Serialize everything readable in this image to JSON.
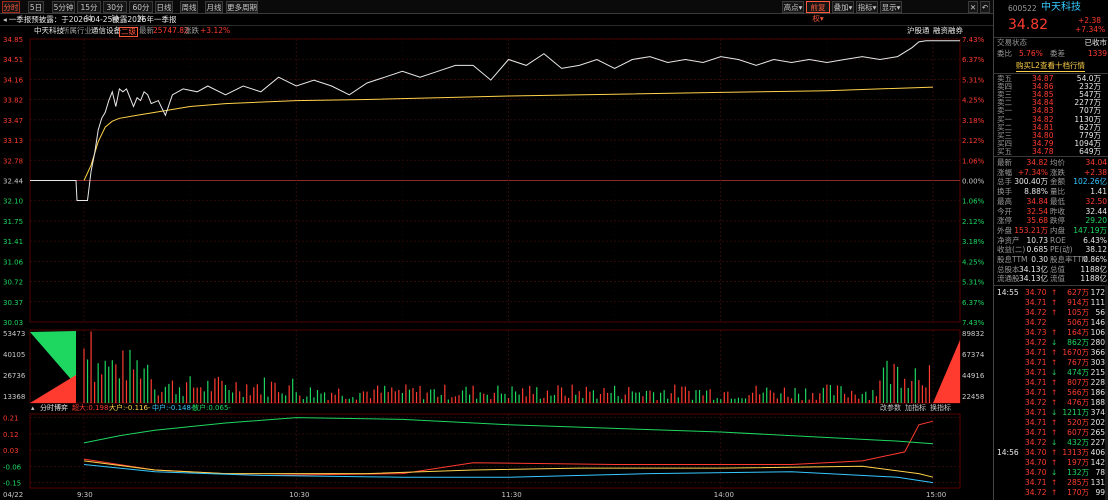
{
  "toolbar": {
    "periods": [
      "分时",
      "5日",
      "5分钟",
      "15分钟",
      "30分钟",
      "60分钟",
      "日线",
      "周线",
      "月线",
      "更多周期"
    ],
    "right_buttons": [
      "叠加",
      "指标",
      "显示"
    ],
    "dropdowns": [
      "高点",
      "前复权"
    ],
    "close_glyph": "✕",
    "back_glyph": "↶"
  },
  "info": {
    "text": "一季报预披露：于2026-04-25披露2026年一季报"
  },
  "selection": {
    "name": "中天科技",
    "industry_label": "所属行业:",
    "industry": "通信设备",
    "tag": "二级",
    "latest_label": "最新",
    "latest": "25747.82",
    "change_label": "涨跌",
    "change": "+3.12%",
    "links": [
      "沪股通",
      "融资融券"
    ]
  },
  "axis": {
    "left_prices": [
      "34.85",
      "34.51",
      "34.16",
      "33.82",
      "33.47",
      "33.13",
      "32.78",
      "32.44",
      "32.10",
      "31.75",
      "31.41",
      "31.06",
      "30.72",
      "30.37",
      "30.03"
    ],
    "right_pcts": [
      "7.43%",
      "6.37%",
      "5.31%",
      "4.25%",
      "3.18%",
      "2.12%",
      "1.06%",
      "0.00%",
      "1.06%",
      "2.12%",
      "3.18%",
      "4.25%",
      "5.31%",
      "6.37%",
      "7.43%"
    ],
    "vol_left": [
      "53473",
      "40105",
      "26736",
      "13368"
    ],
    "vol_right": [
      "89832",
      "67374",
      "44916",
      "22458"
    ],
    "flow_left": [
      "0.21",
      "0.12",
      "0.03",
      "-0.06",
      "-0.15"
    ],
    "time_labels": [
      "04/22",
      "9:30",
      "10:30",
      "11:30",
      "14:00",
      "15:00"
    ]
  },
  "flow_legend": {
    "title": "分时博弈",
    "super": "超大:0.198-",
    "large": "大户:-0.116-",
    "mid": "中户:-0.148-",
    "retail": "散户:0.065-",
    "buttons": [
      "改参数",
      "加指标",
      "换指标"
    ]
  },
  "chart_data": {
    "type": "line",
    "y_unit": "price",
    "prev_close": 32.44,
    "ylim": [
      30.03,
      34.85
    ],
    "x_range": [
      "9:30",
      "15:00"
    ],
    "price_series": {
      "name": "price",
      "points": [
        [
          0,
          32.1
        ],
        [
          1,
          32.1
        ],
        [
          2,
          32.6
        ],
        [
          3,
          32.9
        ],
        [
          4,
          33.3
        ],
        [
          5,
          33.5
        ],
        [
          6,
          33.6
        ],
        [
          7,
          33.8
        ],
        [
          8,
          33.95
        ],
        [
          9,
          33.7
        ],
        [
          10,
          34.0
        ],
        [
          11,
          33.95
        ],
        [
          12,
          34.0
        ],
        [
          13,
          33.85
        ],
        [
          14,
          33.7
        ],
        [
          15,
          33.85
        ],
        [
          16,
          33.8
        ],
        [
          17,
          33.95
        ],
        [
          18,
          33.9
        ],
        [
          19,
          33.75
        ],
        [
          21,
          33.8
        ],
        [
          23,
          33.55
        ],
        [
          25,
          33.9
        ],
        [
          28,
          34.0
        ],
        [
          32,
          33.95
        ],
        [
          35,
          34.05
        ],
        [
          40,
          33.9
        ],
        [
          45,
          34.05
        ],
        [
          50,
          33.95
        ],
        [
          55,
          34.2
        ],
        [
          60,
          34.05
        ],
        [
          65,
          34.15
        ],
        [
          70,
          34.05
        ],
        [
          75,
          33.9
        ],
        [
          80,
          34.1
        ],
        [
          85,
          34.2
        ],
        [
          90,
          34.3
        ],
        [
          95,
          34.2
        ],
        [
          100,
          34.3
        ],
        [
          105,
          34.4
        ],
        [
          110,
          34.4
        ],
        [
          115,
          34.15
        ],
        [
          120,
          34.5
        ],
        [
          125,
          34.4
        ],
        [
          130,
          34.6
        ],
        [
          135,
          34.35
        ],
        [
          140,
          34.4
        ],
        [
          145,
          34.5
        ],
        [
          150,
          34.35
        ],
        [
          155,
          34.5
        ],
        [
          160,
          34.55
        ],
        [
          165,
          34.45
        ],
        [
          170,
          34.5
        ],
        [
          175,
          34.45
        ],
        [
          180,
          34.55
        ],
        [
          185,
          34.5
        ],
        [
          190,
          34.4
        ],
        [
          195,
          34.5
        ],
        [
          200,
          34.45
        ],
        [
          205,
          34.5
        ],
        [
          210,
          34.45
        ],
        [
          215,
          34.5
        ],
        [
          220,
          34.55
        ],
        [
          225,
          34.5
        ],
        [
          230,
          34.55
        ],
        [
          234,
          34.7
        ],
        [
          236,
          34.8
        ],
        [
          238,
          34.82
        ],
        [
          240,
          34.82
        ]
      ]
    },
    "avg_series": {
      "name": "avg",
      "points": [
        [
          0,
          32.44
        ],
        [
          2,
          32.7
        ],
        [
          4,
          33.1
        ],
        [
          6,
          33.35
        ],
        [
          8,
          33.45
        ],
        [
          10,
          33.5
        ],
        [
          15,
          33.55
        ],
        [
          20,
          33.6
        ],
        [
          30,
          33.7
        ],
        [
          40,
          33.75
        ],
        [
          60,
          33.8
        ],
        [
          80,
          33.82
        ],
        [
          100,
          33.85
        ],
        [
          120,
          33.88
        ],
        [
          150,
          33.91
        ],
        [
          180,
          33.94
        ],
        [
          210,
          33.97
        ],
        [
          240,
          34.03
        ]
      ]
    },
    "volume_note": "per-minute volume bars, ylim [0, 53473]",
    "flow_series": [
      {
        "name": "超大",
        "color": "#ff3b30",
        "points": [
          [
            0,
            -0.02
          ],
          [
            20,
            -0.08
          ],
          [
            50,
            -0.11
          ],
          [
            90,
            -0.1
          ],
          [
            110,
            -0.04
          ],
          [
            150,
            -0.05
          ],
          [
            200,
            -0.05
          ],
          [
            220,
            -0.03
          ],
          [
            232,
            0.02
          ],
          [
            236,
            0.17
          ],
          [
            240,
            0.19
          ]
        ]
      },
      {
        "name": "大户",
        "color": "#ffd24a",
        "points": [
          [
            0,
            -0.03
          ],
          [
            20,
            -0.08
          ],
          [
            40,
            -0.1
          ],
          [
            80,
            -0.1
          ],
          [
            110,
            -0.08
          ],
          [
            140,
            -0.07
          ],
          [
            180,
            -0.07
          ],
          [
            220,
            -0.06
          ],
          [
            236,
            -0.1
          ],
          [
            240,
            -0.12
          ]
        ]
      },
      {
        "name": "中户",
        "color": "#35c8ff",
        "points": [
          [
            0,
            -0.05
          ],
          [
            20,
            -0.09
          ],
          [
            50,
            -0.11
          ],
          [
            90,
            -0.12
          ],
          [
            120,
            -0.12
          ],
          [
            160,
            -0.1
          ],
          [
            200,
            -0.09
          ],
          [
            230,
            -0.12
          ],
          [
            240,
            -0.15
          ]
        ]
      },
      {
        "name": "散户",
        "color": "#1ed760",
        "points": [
          [
            0,
            0.07
          ],
          [
            10,
            0.11
          ],
          [
            20,
            0.14
          ],
          [
            40,
            0.18
          ],
          [
            60,
            0.21
          ],
          [
            90,
            0.2
          ],
          [
            120,
            0.17
          ],
          [
            150,
            0.15
          ],
          [
            180,
            0.13
          ],
          [
            210,
            0.1
          ],
          [
            230,
            0.08
          ],
          [
            240,
            0.065
          ]
        ]
      }
    ]
  },
  "side": {
    "code": "600522",
    "name": "中天科技",
    "price": "34.82",
    "change": "+2.38",
    "change_pct": "+7.34%",
    "status_label": "交易状态",
    "status": "已收市",
    "webi_label": "委比",
    "webi": "5.76%",
    "weicha_label": "委差",
    "weicha": "1339",
    "broker_banner": "购买L2查看十档行情",
    "asks": [
      {
        "label": "卖五",
        "price": "34.87",
        "vol": "54.0万"
      },
      {
        "label": "卖四",
        "price": "34.86",
        "vol": "232万"
      },
      {
        "label": "卖三",
        "price": "34.85",
        "vol": "547万"
      },
      {
        "label": "卖二",
        "price": "34.84",
        "vol": "2277万"
      },
      {
        "label": "卖一",
        "price": "34.83",
        "vol": "707万"
      }
    ],
    "bids": [
      {
        "label": "买一",
        "price": "34.82",
        "vol": "1130万"
      },
      {
        "label": "买二",
        "price": "34.81",
        "vol": "627万"
      },
      {
        "label": "买三",
        "price": "34.80",
        "vol": "779万"
      },
      {
        "label": "买四",
        "price": "34.79",
        "vol": "1094万"
      },
      {
        "label": "买五",
        "price": "34.78",
        "vol": "649万"
      }
    ],
    "stats": [
      {
        "l1": "最新",
        "v1": "34.82",
        "c1": "red",
        "l2": "均价",
        "v2": "34.04",
        "c2": "red"
      },
      {
        "l1": "涨幅",
        "v1": "+7.34%",
        "c1": "red",
        "l2": "涨跌",
        "v2": "+2.38",
        "c2": "red"
      },
      {
        "l1": "总手",
        "v1": "300.40万",
        "c1": "white",
        "l2": "金额",
        "v2": "102.26亿",
        "c2": "cyan"
      },
      {
        "l1": "换手",
        "v1": "8.88%",
        "c1": "white",
        "l2": "量比",
        "v2": "1.41",
        "c2": "white"
      },
      {
        "l1": "最高",
        "v1": "34.84",
        "c1": "red",
        "l2": "最低",
        "v2": "32.50",
        "c2": "red"
      },
      {
        "l1": "今开",
        "v1": "32.54",
        "c1": "red",
        "l2": "昨收",
        "v2": "32.44",
        "c2": "white"
      },
      {
        "l1": "涨停",
        "v1": "35.68",
        "c1": "red",
        "l2": "跌停",
        "v2": "29.20",
        "c2": "green"
      },
      {
        "l1": "外盘",
        "v1": "153.21万",
        "c1": "red",
        "l2": "内盘",
        "v2": "147.19万",
        "c2": "green"
      },
      {
        "l1": "净资产",
        "v1": "10.73",
        "c1": "white",
        "l2": "ROE",
        "v2": "6.43%",
        "c2": "white"
      },
      {
        "l1": "收益(二)",
        "v1": "0.685",
        "c1": "white",
        "l2": "PE(动)",
        "v2": "38.12",
        "c2": "white"
      },
      {
        "l1": "股息TTM",
        "v1": "0.30",
        "c1": "white",
        "l2": "股息率TTM",
        "v2": "0.86%",
        "c2": "white"
      },
      {
        "l1": "总股本",
        "v1": "34.13亿",
        "c1": "white",
        "l2": "总值",
        "v2": "1188亿",
        "c2": "white"
      },
      {
        "l1": "流通股",
        "v1": "34.13亿",
        "c1": "white",
        "l2": "流值",
        "v2": "1188亿",
        "c2": "white"
      }
    ],
    "ticks": [
      {
        "t": "14:55",
        "p": "34.70",
        "a": "↑",
        "v": "627万",
        "vc": "red",
        "n": "172"
      },
      {
        "t": "",
        "p": "34.71",
        "a": "↑",
        "v": "914万",
        "vc": "red",
        "n": "111"
      },
      {
        "t": "",
        "p": "34.72",
        "a": "↑",
        "v": "105万",
        "vc": "red",
        "n": "56"
      },
      {
        "t": "",
        "p": "34.72",
        "a": "",
        "v": "506万",
        "vc": "red",
        "n": "146"
      },
      {
        "t": "",
        "p": "34.73",
        "a": "↑",
        "v": "164万",
        "vc": "red",
        "n": "106"
      },
      {
        "t": "",
        "p": "34.72",
        "a": "↓",
        "v": "862万",
        "vc": "green",
        "n": "280"
      },
      {
        "t": "",
        "p": "34.71",
        "a": "↑",
        "v": "1670万",
        "vc": "red",
        "n": "366"
      },
      {
        "t": "",
        "p": "34.71",
        "a": "↑",
        "v": "767万",
        "vc": "red",
        "n": "303"
      },
      {
        "t": "",
        "p": "34.71",
        "a": "↓",
        "v": "474万",
        "vc": "green",
        "n": "215"
      },
      {
        "t": "",
        "p": "34.71",
        "a": "↑",
        "v": "807万",
        "vc": "red",
        "n": "228"
      },
      {
        "t": "",
        "p": "34.71",
        "a": "↑",
        "v": "566万",
        "vc": "red",
        "n": "186"
      },
      {
        "t": "",
        "p": "34.72",
        "a": "↑",
        "v": "476万",
        "vc": "red",
        "n": "188"
      },
      {
        "t": "",
        "p": "34.71",
        "a": "↓",
        "v": "1211万",
        "vc": "green",
        "n": "374"
      },
      {
        "t": "",
        "p": "34.71",
        "a": "↑",
        "v": "520万",
        "vc": "red",
        "n": "202"
      },
      {
        "t": "",
        "p": "34.71",
        "a": "↑",
        "v": "607万",
        "vc": "red",
        "n": "265"
      },
      {
        "t": "",
        "p": "34.72",
        "a": "↓",
        "v": "432万",
        "vc": "green",
        "n": "227"
      },
      {
        "t": "14:56",
        "p": "34.70",
        "a": "↑",
        "v": "1313万",
        "vc": "red",
        "n": "406"
      },
      {
        "t": "",
        "p": "34.70",
        "a": "↑",
        "v": "197万",
        "vc": "red",
        "n": "142"
      },
      {
        "t": "",
        "p": "34.70",
        "a": "↓",
        "v": "132万",
        "vc": "green",
        "n": "78"
      },
      {
        "t": "",
        "p": "34.71",
        "a": "↑",
        "v": "285万",
        "vc": "red",
        "n": "131"
      },
      {
        "t": "",
        "p": "34.72",
        "a": "↑",
        "v": "170万",
        "vc": "red",
        "n": "99"
      }
    ]
  }
}
